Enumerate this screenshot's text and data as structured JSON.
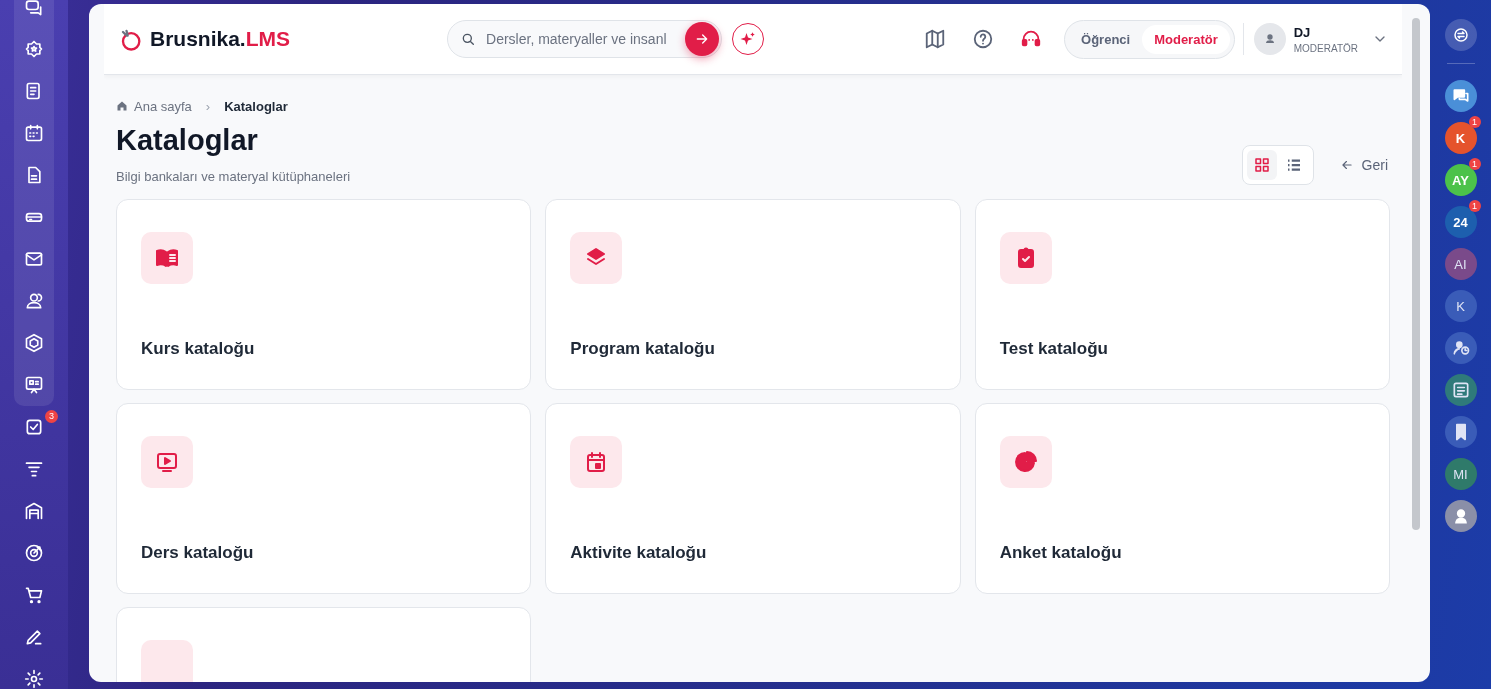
{
  "left_nav": {
    "badge": "3"
  },
  "header": {
    "logo": {
      "name": "Brusnika.",
      "suffix": "LMS"
    },
    "search": {
      "placeholder": "Dersler, materyaller ve insanl"
    },
    "roles": [
      {
        "label": "Öğrenci",
        "selected": false
      },
      {
        "label": "Moderatör",
        "selected": true
      }
    ],
    "user": {
      "name": "DJ",
      "role": "MODERATÖR"
    }
  },
  "breadcrumb_separator": "›",
  "breadcrumb": [
    {
      "label": "Ana sayfa",
      "current": false
    },
    {
      "label": "Kataloglar",
      "current": true
    }
  ],
  "page": {
    "title": "Kataloglar",
    "subtitle": "Bilgi bankaları ve materyal kütüphaneleri",
    "back": "Geri"
  },
  "view_modes": [
    {
      "kind": "grid",
      "selected": true
    },
    {
      "kind": "list",
      "selected": false
    }
  ],
  "catalogs": [
    {
      "kind": "book",
      "title": "Kurs kataloğu"
    },
    {
      "kind": "layers",
      "title": "Program kataloğu"
    },
    {
      "kind": "clipboard",
      "title": "Test kataloğu"
    },
    {
      "kind": "video",
      "title": "Ders kataloğu"
    },
    {
      "kind": "calendar",
      "title": "Aktivite kataloğu"
    },
    {
      "kind": "pie",
      "title": "Anket kataloğu"
    },
    {
      "kind": "blank"
    }
  ],
  "contacts": [
    {
      "kind": "chat",
      "dimmed": false,
      "color": "#4a8fd8"
    },
    {
      "kind": "initials",
      "initials": "K",
      "badge": "1",
      "dimmed": false,
      "color": "#e5532c"
    },
    {
      "kind": "initials",
      "initials": "AY",
      "badge": "1",
      "dimmed": false,
      "color": "#4cc24a"
    },
    {
      "kind": "initials",
      "initials": "24",
      "badge": "1",
      "dimmed": false,
      "color": "#1d5fae"
    },
    {
      "kind": "initials",
      "initials": "AI",
      "dimmed": true,
      "color": "#7a4a8a"
    },
    {
      "kind": "initials",
      "initials": "K",
      "dimmed": true,
      "color": "#3a5cb8"
    },
    {
      "kind": "person",
      "dimmed": true,
      "color": "#3a5cb8"
    },
    {
      "kind": "board",
      "dimmed": true,
      "color": "#2f7a7a"
    },
    {
      "kind": "bookmark",
      "dimmed": true,
      "color": "#3a5cb8"
    },
    {
      "kind": "initials",
      "initials": "MI",
      "dimmed": true,
      "color": "#2f7a6a"
    },
    {
      "kind": "photo",
      "dimmed": false,
      "color": "#8a8fa8"
    }
  ]
}
